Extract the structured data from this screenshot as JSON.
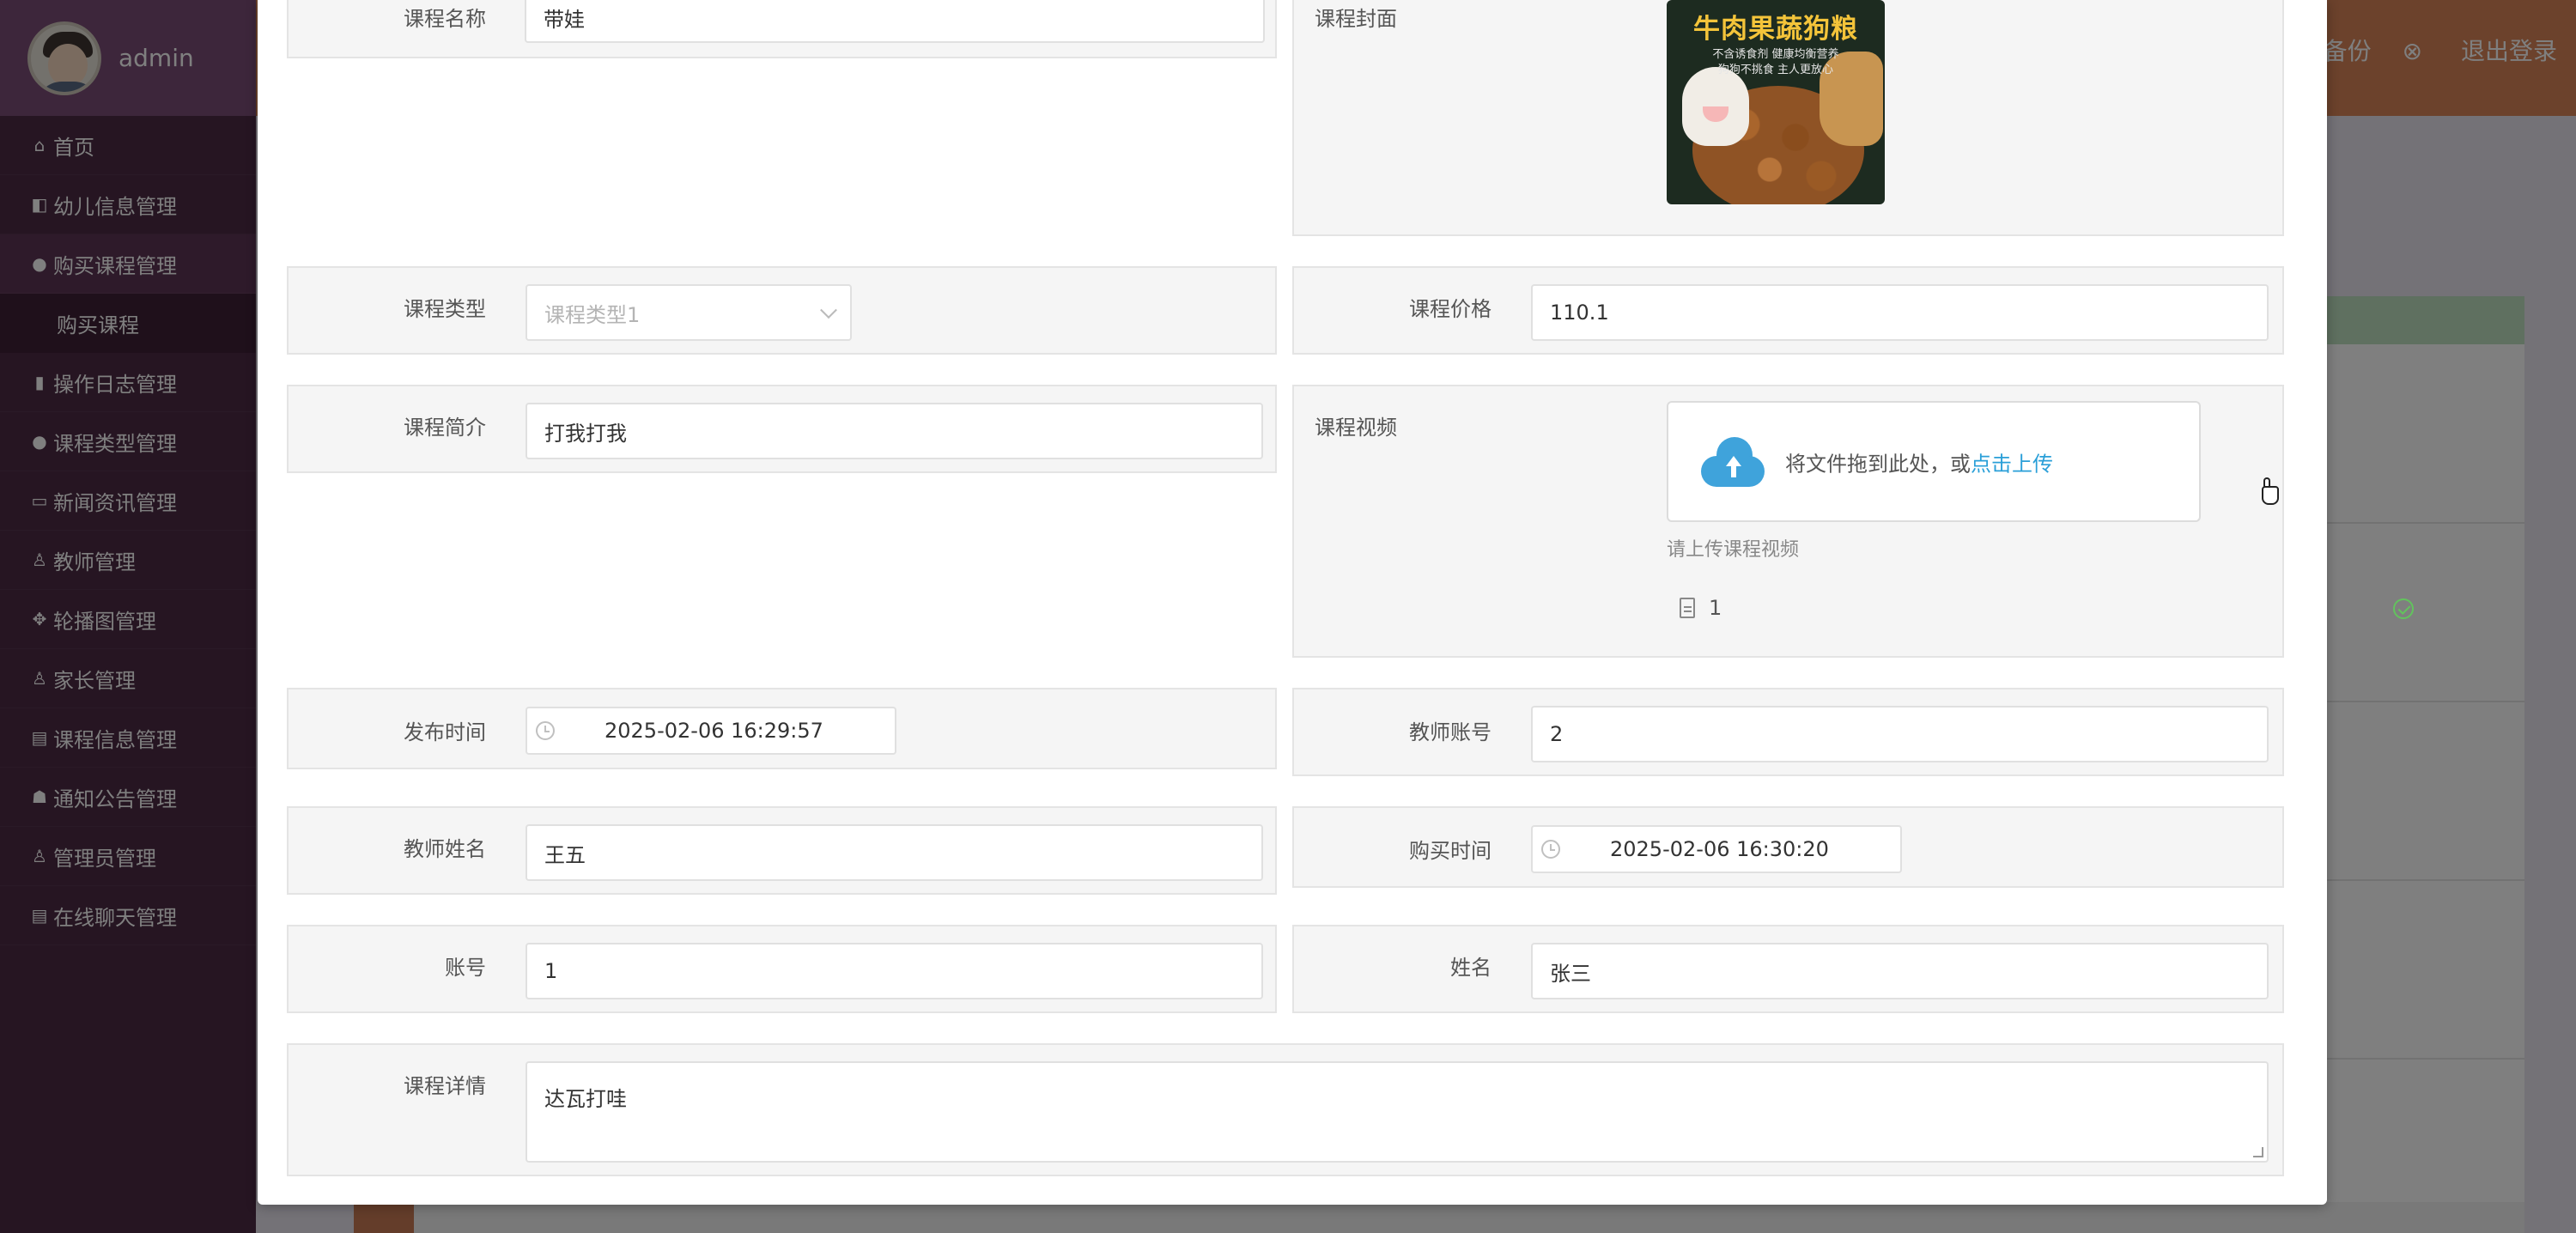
{
  "user": {
    "name": "admin"
  },
  "header": {
    "backup_label": "据备份",
    "logout_label": "退出登录"
  },
  "sidebar": {
    "items": [
      {
        "label": "首页",
        "icon": "home-icon",
        "glyph": "⌂"
      },
      {
        "label": "幼儿信息管理",
        "icon": "id-card-icon",
        "glyph": "◧"
      },
      {
        "label": "购买课程管理",
        "icon": "circle-icon",
        "glyph": "●"
      },
      {
        "label": "操作日志管理",
        "icon": "book-icon",
        "glyph": "▮"
      },
      {
        "label": "课程类型管理",
        "icon": "circle-icon",
        "glyph": "●"
      },
      {
        "label": "新闻资讯管理",
        "icon": "briefcase-icon",
        "glyph": "▭"
      },
      {
        "label": "教师管理",
        "icon": "user-icon",
        "glyph": "♙"
      },
      {
        "label": "轮播图管理",
        "icon": "grid-icon",
        "glyph": "✥"
      },
      {
        "label": "家长管理",
        "icon": "user-lock-icon",
        "glyph": "♙"
      },
      {
        "label": "课程信息管理",
        "icon": "table-icon",
        "glyph": "▤"
      },
      {
        "label": "通知公告管理",
        "icon": "users-icon",
        "glyph": "☗"
      },
      {
        "label": "管理员管理",
        "icon": "user-icon",
        "glyph": "♙"
      },
      {
        "label": "在线聊天管理",
        "icon": "table-icon",
        "glyph": "▤"
      }
    ],
    "sub_item": "购买课程"
  },
  "form": {
    "course_name": {
      "label": "课程名称",
      "value": "带娃"
    },
    "course_cover": {
      "label": "课程封面",
      "image_title": "牛肉果蔬狗粮",
      "image_line1": "不含诱食剂 健康均衡营养",
      "image_line2": "狗狗不挑食 主人更放心"
    },
    "course_type": {
      "label": "课程类型",
      "value": "课程类型1"
    },
    "course_price": {
      "label": "课程价格",
      "value": "110.1"
    },
    "course_intro": {
      "label": "课程简介",
      "value": "打我打我"
    },
    "course_video": {
      "label": "课程视频",
      "upload_text": "将文件拖到此处，或",
      "upload_link": "点击上传",
      "tip": "请上传课程视频",
      "file_name": "1"
    },
    "publish_time": {
      "label": "发布时间",
      "value": "2025-02-06 16:29:57"
    },
    "teacher_account": {
      "label": "教师账号",
      "value": "2"
    },
    "teacher_name": {
      "label": "教师姓名",
      "value": "王五"
    },
    "purchase_time": {
      "label": "购买时间",
      "value": "2025-02-06 16:30:20"
    },
    "account": {
      "label": "账号",
      "value": "1"
    },
    "name": {
      "label": "姓名",
      "value": "张三"
    },
    "course_detail": {
      "label": "课程详情",
      "value": "达瓦打哇"
    }
  },
  "colors": {
    "sidebar_bg": "#4c2a45",
    "header_bg": "#d88558",
    "link": "#2a9fd8",
    "upload_icon": "#3fa3db",
    "success": "#62c35d"
  }
}
